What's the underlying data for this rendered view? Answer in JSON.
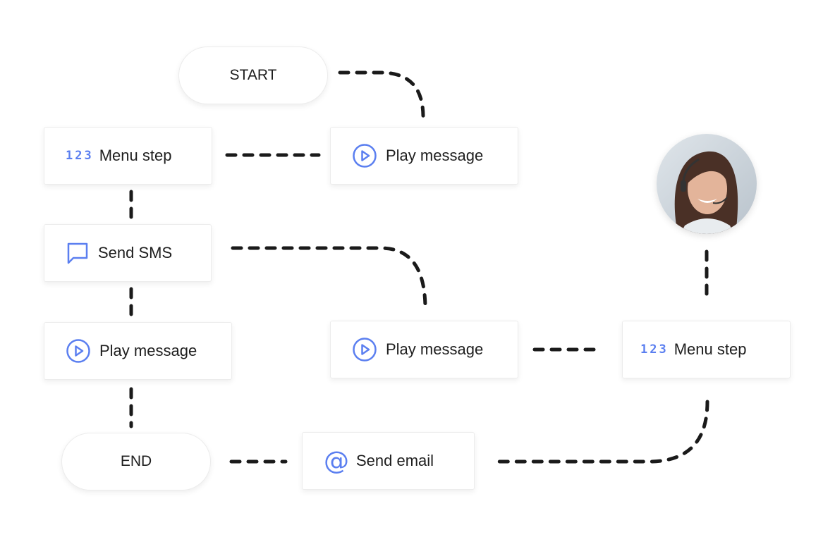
{
  "nodes": {
    "start": "START",
    "end": "END",
    "menu_step_1": "Menu step",
    "menu_step_2": "Menu step",
    "play_message_1": "Play message",
    "play_message_2": "Play message",
    "play_message_3": "Play message",
    "send_sms": "Send SMS",
    "send_email": "Send email",
    "menu_digits": "123"
  },
  "colors": {
    "accent": "#5b7ff0",
    "connector": "#1a1a1a",
    "text": "#1e1e1e"
  },
  "icons": {
    "menu": "digits-123-icon",
    "play": "play-circle-icon",
    "sms": "chat-bubble-icon",
    "email": "at-sign-icon",
    "agent": "agent-avatar"
  }
}
